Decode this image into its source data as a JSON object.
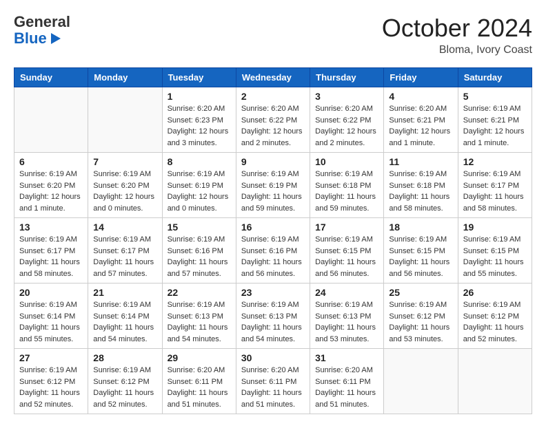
{
  "logo": {
    "general": "General",
    "blue": "Blue"
  },
  "header": {
    "month": "October 2024",
    "location": "Bloma, Ivory Coast"
  },
  "weekdays": [
    "Sunday",
    "Monday",
    "Tuesday",
    "Wednesday",
    "Thursday",
    "Friday",
    "Saturday"
  ],
  "weeks": [
    [
      {
        "day": "",
        "info": ""
      },
      {
        "day": "",
        "info": ""
      },
      {
        "day": "1",
        "info": "Sunrise: 6:20 AM\nSunset: 6:23 PM\nDaylight: 12 hours and 3 minutes."
      },
      {
        "day": "2",
        "info": "Sunrise: 6:20 AM\nSunset: 6:22 PM\nDaylight: 12 hours and 2 minutes."
      },
      {
        "day": "3",
        "info": "Sunrise: 6:20 AM\nSunset: 6:22 PM\nDaylight: 12 hours and 2 minutes."
      },
      {
        "day": "4",
        "info": "Sunrise: 6:20 AM\nSunset: 6:21 PM\nDaylight: 12 hours and 1 minute."
      },
      {
        "day": "5",
        "info": "Sunrise: 6:19 AM\nSunset: 6:21 PM\nDaylight: 12 hours and 1 minute."
      }
    ],
    [
      {
        "day": "6",
        "info": "Sunrise: 6:19 AM\nSunset: 6:20 PM\nDaylight: 12 hours and 1 minute."
      },
      {
        "day": "7",
        "info": "Sunrise: 6:19 AM\nSunset: 6:20 PM\nDaylight: 12 hours and 0 minutes."
      },
      {
        "day": "8",
        "info": "Sunrise: 6:19 AM\nSunset: 6:19 PM\nDaylight: 12 hours and 0 minutes."
      },
      {
        "day": "9",
        "info": "Sunrise: 6:19 AM\nSunset: 6:19 PM\nDaylight: 11 hours and 59 minutes."
      },
      {
        "day": "10",
        "info": "Sunrise: 6:19 AM\nSunset: 6:18 PM\nDaylight: 11 hours and 59 minutes."
      },
      {
        "day": "11",
        "info": "Sunrise: 6:19 AM\nSunset: 6:18 PM\nDaylight: 11 hours and 58 minutes."
      },
      {
        "day": "12",
        "info": "Sunrise: 6:19 AM\nSunset: 6:17 PM\nDaylight: 11 hours and 58 minutes."
      }
    ],
    [
      {
        "day": "13",
        "info": "Sunrise: 6:19 AM\nSunset: 6:17 PM\nDaylight: 11 hours and 58 minutes."
      },
      {
        "day": "14",
        "info": "Sunrise: 6:19 AM\nSunset: 6:17 PM\nDaylight: 11 hours and 57 minutes."
      },
      {
        "day": "15",
        "info": "Sunrise: 6:19 AM\nSunset: 6:16 PM\nDaylight: 11 hours and 57 minutes."
      },
      {
        "day": "16",
        "info": "Sunrise: 6:19 AM\nSunset: 6:16 PM\nDaylight: 11 hours and 56 minutes."
      },
      {
        "day": "17",
        "info": "Sunrise: 6:19 AM\nSunset: 6:15 PM\nDaylight: 11 hours and 56 minutes."
      },
      {
        "day": "18",
        "info": "Sunrise: 6:19 AM\nSunset: 6:15 PM\nDaylight: 11 hours and 56 minutes."
      },
      {
        "day": "19",
        "info": "Sunrise: 6:19 AM\nSunset: 6:15 PM\nDaylight: 11 hours and 55 minutes."
      }
    ],
    [
      {
        "day": "20",
        "info": "Sunrise: 6:19 AM\nSunset: 6:14 PM\nDaylight: 11 hours and 55 minutes."
      },
      {
        "day": "21",
        "info": "Sunrise: 6:19 AM\nSunset: 6:14 PM\nDaylight: 11 hours and 54 minutes."
      },
      {
        "day": "22",
        "info": "Sunrise: 6:19 AM\nSunset: 6:13 PM\nDaylight: 11 hours and 54 minutes."
      },
      {
        "day": "23",
        "info": "Sunrise: 6:19 AM\nSunset: 6:13 PM\nDaylight: 11 hours and 54 minutes."
      },
      {
        "day": "24",
        "info": "Sunrise: 6:19 AM\nSunset: 6:13 PM\nDaylight: 11 hours and 53 minutes."
      },
      {
        "day": "25",
        "info": "Sunrise: 6:19 AM\nSunset: 6:12 PM\nDaylight: 11 hours and 53 minutes."
      },
      {
        "day": "26",
        "info": "Sunrise: 6:19 AM\nSunset: 6:12 PM\nDaylight: 11 hours and 52 minutes."
      }
    ],
    [
      {
        "day": "27",
        "info": "Sunrise: 6:19 AM\nSunset: 6:12 PM\nDaylight: 11 hours and 52 minutes."
      },
      {
        "day": "28",
        "info": "Sunrise: 6:19 AM\nSunset: 6:12 PM\nDaylight: 11 hours and 52 minutes."
      },
      {
        "day": "29",
        "info": "Sunrise: 6:20 AM\nSunset: 6:11 PM\nDaylight: 11 hours and 51 minutes."
      },
      {
        "day": "30",
        "info": "Sunrise: 6:20 AM\nSunset: 6:11 PM\nDaylight: 11 hours and 51 minutes."
      },
      {
        "day": "31",
        "info": "Sunrise: 6:20 AM\nSunset: 6:11 PM\nDaylight: 11 hours and 51 minutes."
      },
      {
        "day": "",
        "info": ""
      },
      {
        "day": "",
        "info": ""
      }
    ]
  ]
}
